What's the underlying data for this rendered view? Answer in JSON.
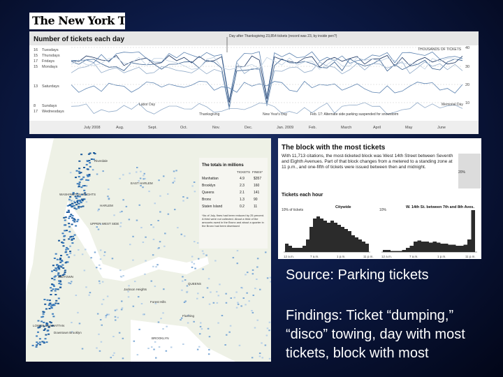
{
  "logo": {
    "text": "The New York Times"
  },
  "top_chart": {
    "title": "Number of tickets each day",
    "days": [
      "Tuesdays",
      "Thursdays",
      "Fridays",
      "Mondays",
      "Saturdays",
      "Sundays",
      "Wednesdays"
    ],
    "day_values": [
      "16",
      "15",
      "17",
      "15",
      "13",
      "8",
      "17"
    ],
    "annotation": "Day after Thanksgiving 23,854 tickets (record was 23, by inside pen?)",
    "units": "THOUSANDS OF TICKETS",
    "y_ticks": [
      "40",
      "30",
      "20",
      "10"
    ],
    "months": [
      "July 2008",
      "Aug.",
      "Sept.",
      "Oct.",
      "Nov.",
      "Dec.",
      "Jan. 2009",
      "Feb.",
      "March",
      "April",
      "May",
      "June"
    ],
    "holidays": [
      "Labor Day",
      "Thanksgiving",
      "New Year's Day",
      "Memorial Day"
    ],
    "note": "Feb. 17: Alternate side parking suspended for snowstorm"
  },
  "map": {
    "totals_title": "The totals in millions",
    "totals_headers": [
      "TICKETS",
      "FINES*"
    ],
    "boroughs": [
      {
        "name": "Manhattan",
        "tickets": "4.9",
        "fines": "$357"
      },
      {
        "name": "Brooklyn",
        "tickets": "2.3",
        "fines": "160"
      },
      {
        "name": "Queens",
        "tickets": "2.1",
        "fines": "141"
      },
      {
        "name": "Bronx",
        "tickets": "1.3",
        "fines": "90"
      },
      {
        "name": "Staten Island",
        "tickets": "0.2",
        "fines": "11"
      }
    ],
    "footnote": "*As of July, fines had been reduced by 25 percent. A third were not collected. About a third of the amounts owed in the Bronx and about a quarter in the Bronx had been dismissed",
    "labels": [
      "Riverdale",
      "WASHINGTON HEIGHTS",
      "UPPER WEST SIDE",
      "EAST HARLEM",
      "HARLEM",
      "MIDTOWN",
      "QUEENS",
      "LOWER MANHATTAN",
      "Jackson Heights",
      "Flushing",
      "Downtown Brooklyn",
      "BROOKLYN",
      "Forest Hills"
    ]
  },
  "block": {
    "title": "The block with the most tickets",
    "desc": "With 11,713 citations, the most-ticketed block was West 14th Street between Seventh and Eighth Avenues. Part of that block changes from a metered to a standing zone at 11 p.m., and one-fifth of tickets were issued between then and midnight.",
    "hourly_title": "Tickets each hour",
    "citywide_label": "Citywide",
    "block_label": "W. 14th St. between 7th and 8th Aves.",
    "y_label": "10% of tickets",
    "x_ticks_left": [
      "12 a.m.",
      "7 a.m.",
      "1 p.m.",
      "11 p.m."
    ],
    "x_ticks_right": [
      "12 a.m.",
      "7 a.m.",
      "1 p.m.",
      "11 p.m."
    ],
    "peak_label": "20%"
  },
  "source_text": "Source:  Parking tickets",
  "findings_text": "Findings: Ticket “dumping,” “disco” towing, day with most tickets, block with most"
}
